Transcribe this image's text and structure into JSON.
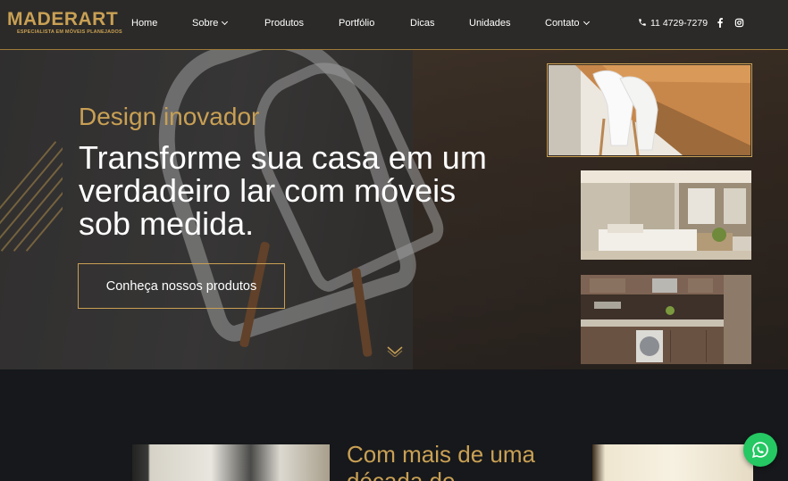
{
  "header": {
    "logo": {
      "name": "MADERART",
      "tagline": "ESPECIALISTA EM MÓVEIS PLANEJADOS"
    },
    "nav": [
      {
        "label": "Home",
        "dropdown": false
      },
      {
        "label": "Sobre",
        "dropdown": true
      },
      {
        "label": "Produtos",
        "dropdown": false
      },
      {
        "label": "Portfólio",
        "dropdown": false
      },
      {
        "label": "Dicas",
        "dropdown": false
      },
      {
        "label": "Unidades",
        "dropdown": false
      },
      {
        "label": "Contato",
        "dropdown": true
      }
    ],
    "phone": "11 4729-7279",
    "social": {
      "facebook_icon": "facebook-icon",
      "instagram_icon": "instagram-icon"
    }
  },
  "hero": {
    "eyebrow": "Design inovador",
    "headline": "Transforme sua casa em um verdadeiro lar com móveis sob medida.",
    "cta_label": "Conheça nossos produtos",
    "thumbnails": [
      {
        "subject": "wooden desk with white chair",
        "active": true
      },
      {
        "subject": "bedroom",
        "active": false
      },
      {
        "subject": "kitchen",
        "active": false
      }
    ]
  },
  "about": {
    "title_line1": "Com mais de uma",
    "title_line2": "década de"
  },
  "colors": {
    "gold": "#c9a054",
    "header_bg": "#2b2a28",
    "dark_bg": "#16181b",
    "whatsapp": "#25c863"
  }
}
